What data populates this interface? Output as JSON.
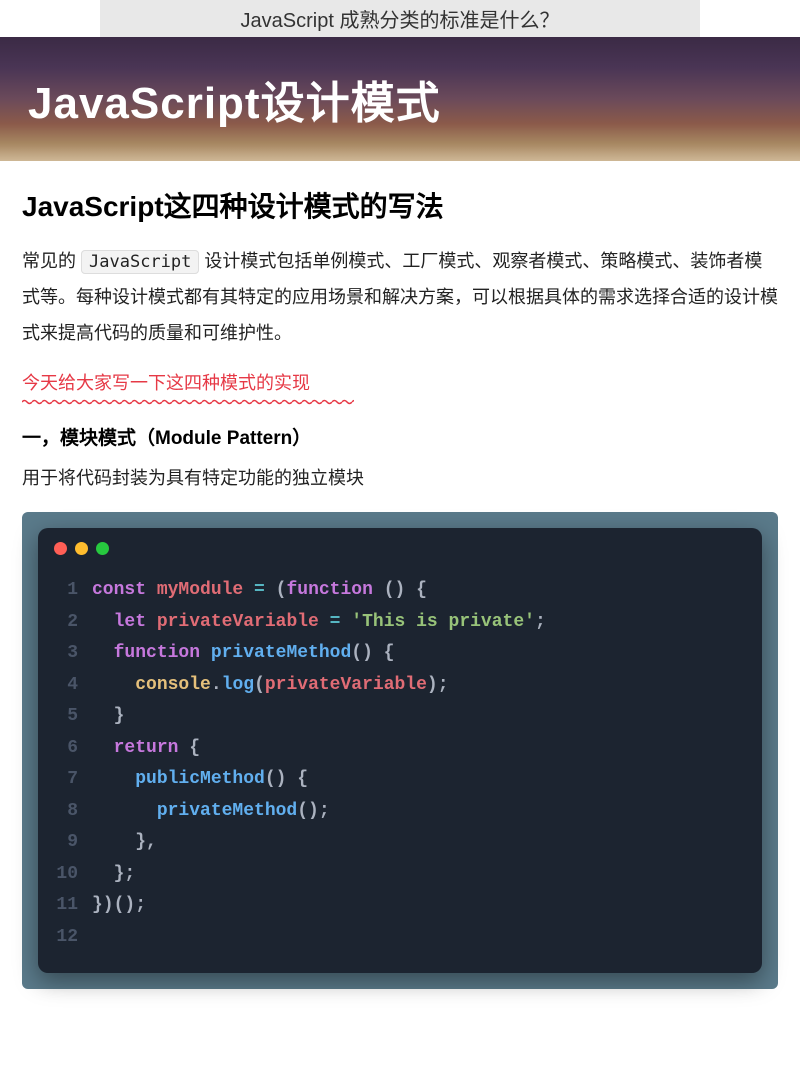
{
  "top_question": "JavaScript 成熟分类的标准是什么？",
  "hero_title": "JavaScript设计模式",
  "heading": "JavaScript这四种设计模式的写法",
  "para_pre": "常见的 ",
  "para_code": "JavaScript",
  "para_post": " 设计模式包括单例模式、工厂模式、观察者模式、策略模式、装饰者模式等。每种设计模式都有其特定的应用场景和解决方案，可以根据具体的需求选择合适的设计模式来提高代码的质量和可维护性。",
  "red_note": "今天给大家写一下这四种模式的实现",
  "section_title": "一，模块模式（Module Pattern）",
  "section_desc": "用于将代码封装为具有特定功能的独立模块",
  "code_lines": [
    {
      "n": "1",
      "tokens": [
        {
          "t": "const ",
          "c": "kw"
        },
        {
          "t": "myModule",
          "c": "var"
        },
        {
          "t": " ",
          "c": "punct"
        },
        {
          "t": "=",
          "c": "op"
        },
        {
          "t": " (",
          "c": "punct"
        },
        {
          "t": "function",
          "c": "fn-kw"
        },
        {
          "t": " () {",
          "c": "punct"
        }
      ]
    },
    {
      "n": "2",
      "tokens": [
        {
          "t": "  ",
          "c": "punct"
        },
        {
          "t": "let ",
          "c": "kw"
        },
        {
          "t": "privateVariable",
          "c": "var"
        },
        {
          "t": " ",
          "c": "punct"
        },
        {
          "t": "=",
          "c": "op"
        },
        {
          "t": " ",
          "c": "punct"
        },
        {
          "t": "'This is private'",
          "c": "str"
        },
        {
          "t": ";",
          "c": "punct"
        }
      ]
    },
    {
      "n": "3",
      "tokens": [
        {
          "t": "  ",
          "c": "punct"
        },
        {
          "t": "function ",
          "c": "fn-kw"
        },
        {
          "t": "privateMethod",
          "c": "name"
        },
        {
          "t": "() {",
          "c": "punct"
        }
      ]
    },
    {
      "n": "4",
      "tokens": [
        {
          "t": "    ",
          "c": "punct"
        },
        {
          "t": "console",
          "c": "obj"
        },
        {
          "t": ".",
          "c": "punct"
        },
        {
          "t": "log",
          "c": "name"
        },
        {
          "t": "(",
          "c": "punct"
        },
        {
          "t": "privateVariable",
          "c": "var"
        },
        {
          "t": ");",
          "c": "punct"
        }
      ]
    },
    {
      "n": "5",
      "tokens": [
        {
          "t": "  }",
          "c": "punct"
        }
      ]
    },
    {
      "n": "6",
      "tokens": [
        {
          "t": "  ",
          "c": "punct"
        },
        {
          "t": "return",
          "c": "kw"
        },
        {
          "t": " {",
          "c": "punct"
        }
      ]
    },
    {
      "n": "7",
      "tokens": [
        {
          "t": "    ",
          "c": "punct"
        },
        {
          "t": "publicMethod",
          "c": "name"
        },
        {
          "t": "() {",
          "c": "punct"
        }
      ]
    },
    {
      "n": "8",
      "tokens": [
        {
          "t": "      ",
          "c": "punct"
        },
        {
          "t": "privateMethod",
          "c": "name"
        },
        {
          "t": "();",
          "c": "punct"
        }
      ]
    },
    {
      "n": "9",
      "tokens": [
        {
          "t": "    },",
          "c": "punct"
        }
      ]
    },
    {
      "n": "10",
      "tokens": [
        {
          "t": "  };",
          "c": "punct"
        }
      ]
    },
    {
      "n": "11",
      "tokens": [
        {
          "t": "})();",
          "c": "punct"
        }
      ]
    },
    {
      "n": "12",
      "tokens": [
        {
          "t": " ",
          "c": "punct"
        }
      ]
    }
  ]
}
